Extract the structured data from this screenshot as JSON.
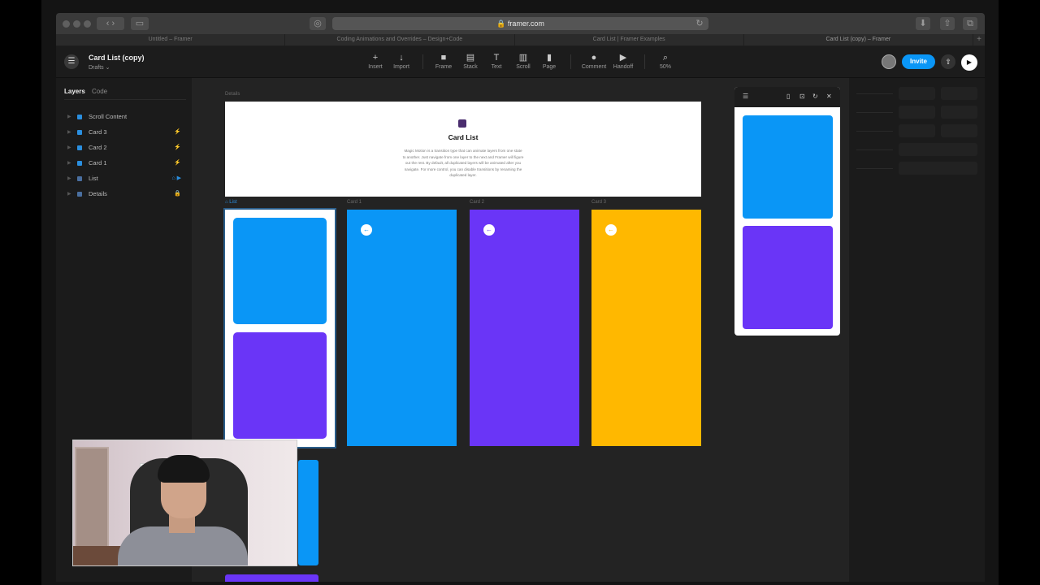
{
  "browser": {
    "url": "framer.com",
    "tabs": [
      "Untitled – Framer",
      "Coding Animations and Overrides – Design+Code",
      "Card List | Framer Examples",
      "Card List (copy) – Framer"
    ],
    "new_tab": "+"
  },
  "toolbar": {
    "menu_icon": "☰",
    "doc_title": "Card List (copy)",
    "doc_subtitle": "Drafts ⌄",
    "tools": [
      {
        "label": "Insert",
        "icon": "+"
      },
      {
        "label": "Import",
        "icon": "↓"
      },
      {
        "label": "Frame",
        "icon": "■"
      },
      {
        "label": "Stack",
        "icon": "▤"
      },
      {
        "label": "Text",
        "icon": "T"
      },
      {
        "label": "Scroll",
        "icon": "▥"
      },
      {
        "label": "Page",
        "icon": "▮"
      },
      {
        "label": "Comment",
        "icon": "●"
      },
      {
        "label": "Handoff",
        "icon": "▶"
      },
      {
        "label": "50%",
        "icon": "⌕"
      }
    ],
    "invite_label": "Invite",
    "share_icon": "⇧",
    "play_icon": "▶"
  },
  "layers_panel": {
    "tabs": [
      "Layers",
      "Code"
    ],
    "items": [
      {
        "label": "Scroll Content",
        "right": ""
      },
      {
        "label": "Card 3",
        "right": "⚡"
      },
      {
        "label": "Card 2",
        "right": "⚡"
      },
      {
        "label": "Card 1",
        "right": "⚡"
      },
      {
        "label": "List",
        "right": "⌂ ▶"
      },
      {
        "label": "Details",
        "right": "🔒"
      }
    ]
  },
  "canvas": {
    "details_label": "Details",
    "details_title": "Card List",
    "details_desc": "Magic Motion is a transition type that can animate layers from one state to another. Just navigate from one layer to the next and Framer will figure out the rest. By default, all duplicated layers will be animated after you navigate. For more control, you can disable transitions by renaming the duplicated layer.",
    "list_label": "⌂ List",
    "card1_label": "Card 1",
    "card2_label": "Card 2",
    "card3_label": "Card 3",
    "back_icon": "←"
  },
  "preview": {
    "menu_icon": "☰",
    "device_icon": "▯",
    "lock_icon": "⊡",
    "refresh_icon": "↻",
    "close_icon": "✕"
  },
  "colors": {
    "blue": "#0a96f6",
    "purple": "#6a35f7",
    "yellow": "#ffb800",
    "invite": "#0a96f6"
  }
}
